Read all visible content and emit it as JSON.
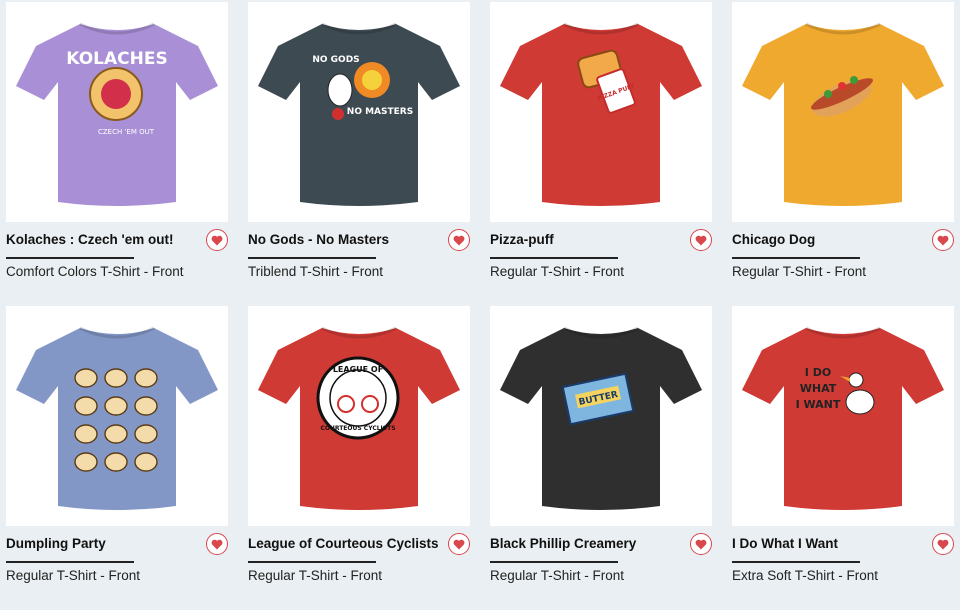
{
  "products": [
    {
      "title": "Kolaches : Czech 'em out!",
      "subtitle": "Comfort Colors T-Shirt - Front",
      "shirt_color": "#a990d6",
      "art": "kolache",
      "art_text": [
        "KOLACHES",
        "CZECH 'EM OUT"
      ]
    },
    {
      "title": "No Gods - No Masters",
      "subtitle": "Triblend T-Shirt - Front",
      "shirt_color": "#3e4a52",
      "art": "goose-fire",
      "art_text": [
        "NO GODS",
        "NO MASTERS"
      ]
    },
    {
      "title": "Pizza-puff",
      "subtitle": "Regular T-Shirt - Front",
      "shirt_color": "#cf3a35",
      "art": "pizza-puff",
      "art_text": [
        "PIZZA PUFF"
      ]
    },
    {
      "title": "Chicago Dog",
      "subtitle": "Regular T-Shirt - Front",
      "shirt_color": "#efa92e",
      "art": "hotdog",
      "art_text": []
    },
    {
      "title": "Dumpling Party",
      "subtitle": "Regular T-Shirt - Front",
      "shirt_color": "#8397c7",
      "art": "dumplings",
      "art_text": []
    },
    {
      "title": "League of Courteous Cyclists",
      "subtitle": "Regular T-Shirt - Front",
      "shirt_color": "#cf3a35",
      "art": "cyclists",
      "art_text": [
        "LEAGUE OF",
        "COURTEOUS CYCLISTS"
      ]
    },
    {
      "title": "Black Phillip Creamery",
      "subtitle": "Regular T-Shirt - Front",
      "shirt_color": "#2f2f2f",
      "art": "butter",
      "art_text": [
        "BUTTER"
      ]
    },
    {
      "title": "I Do What I Want",
      "subtitle": "Extra Soft T-Shirt - Front",
      "shirt_color": "#cf3a35",
      "art": "duck",
      "art_text": [
        "I DO",
        "WHAT",
        "I WANT"
      ]
    }
  ],
  "icons": {
    "favorite": "heart-icon"
  },
  "colors": {
    "heart": "#d8484c",
    "background": "#e9eff2"
  }
}
